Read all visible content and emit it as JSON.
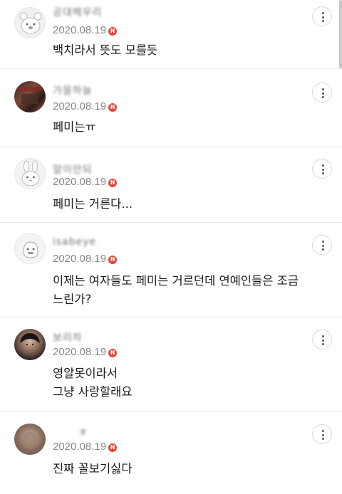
{
  "comments": [
    {
      "username": "공대헤우리",
      "date": "2020.08.19",
      "badge": "N",
      "text": "백치라서 뜻도 모를듯",
      "avatar": "bear-avatar"
    },
    {
      "username": "가을하늘",
      "date": "2020.08.19",
      "badge": "N",
      "text": "페미는ㅠ",
      "avatar": "photo-avatar"
    },
    {
      "username": "말이안되",
      "date": "2020.08.19",
      "badge": "N",
      "text": "페미는 거른다...",
      "avatar": "rabbit-avatar"
    },
    {
      "username": "isabeye",
      "date": "2020.08.19",
      "badge": "N",
      "text": "이제는 여자들도 페미는 거르던데 연예인들은 조금\n느린가?",
      "avatar": "character-avatar"
    },
    {
      "username": "보리차",
      "date": "2020.08.19",
      "badge": "N",
      "text": "영알못이라서\n그냥 사랑할래요",
      "avatar": "person-avatar"
    },
    {
      "username": "ㅎ",
      "date": "2020.08.19",
      "badge": "N",
      "text": "진짜 꼴보기싫다",
      "avatar": "blurred-avatar"
    }
  ],
  "colors": {
    "badge": "#e8443a",
    "date": "#888888",
    "divider": "#ececec"
  },
  "icons": {
    "more": "more-vertical-icon",
    "new": "new-badge-icon"
  }
}
